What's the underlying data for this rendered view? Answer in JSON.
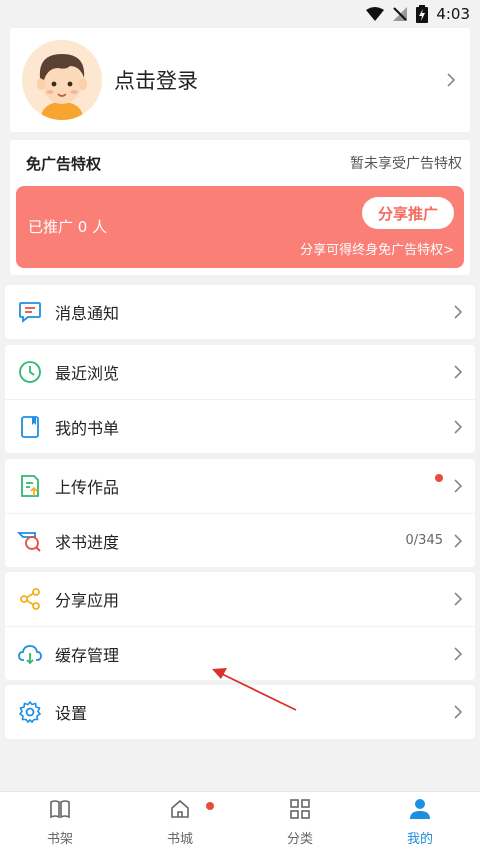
{
  "status_bar": {
    "time": "4:03"
  },
  "profile": {
    "login_label": "点击登录"
  },
  "ad_privilege": {
    "title": "免广告特权",
    "status": "暂未享受广告特权",
    "promoted_count": "已推广 0 人",
    "share_button": "分享推广",
    "share_note": "分享可得终身免广告特权>"
  },
  "menu": {
    "notifications": "消息通知",
    "recent": "最近浏览",
    "booklist": "我的书单",
    "upload": "上传作品",
    "request_progress": "求书进度",
    "request_count": "0/345",
    "share_app": "分享应用",
    "cache": "缓存管理",
    "settings": "设置"
  },
  "tabs": [
    {
      "label": "书架"
    },
    {
      "label": "书城"
    },
    {
      "label": "分类"
    },
    {
      "label": "我的"
    }
  ],
  "colors": {
    "accent": "#1e8fe0",
    "banner": "#f97f77",
    "badge": "#e74c3c"
  }
}
